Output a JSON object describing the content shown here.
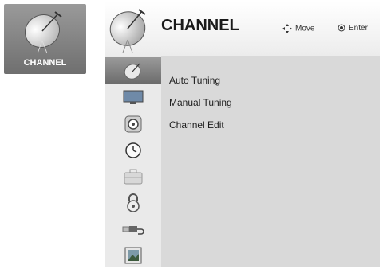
{
  "tile": {
    "label": "CHANNEL",
    "icon": "satellite-dish-icon"
  },
  "header": {
    "title": "CHANNEL",
    "hint_move": "Move",
    "hint_enter": "Enter"
  },
  "sidebar": {
    "items": [
      {
        "icon": "satellite-dish-icon",
        "active": true
      },
      {
        "icon": "monitor-icon"
      },
      {
        "icon": "speaker-icon"
      },
      {
        "icon": "clock-icon"
      },
      {
        "icon": "briefcase-icon"
      },
      {
        "icon": "lock-icon"
      },
      {
        "icon": "usb-plug-icon"
      },
      {
        "icon": "picture-icon"
      }
    ]
  },
  "menu": {
    "items": [
      "Auto Tuning",
      "Manual Tuning",
      "Channel Edit"
    ]
  }
}
